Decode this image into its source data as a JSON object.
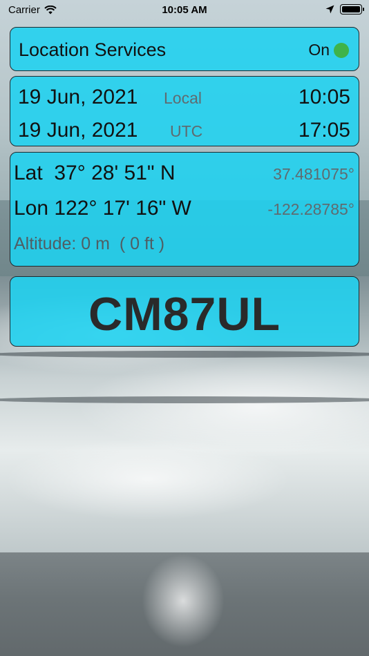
{
  "status_bar": {
    "carrier": "Carrier",
    "time": "10:05 AM"
  },
  "location_services": {
    "label": "Location Services",
    "state": "On",
    "indicator_color": "#3fb34a"
  },
  "datetime": {
    "local": {
      "date": "19 Jun, 2021",
      "zone": "Local",
      "time": "10:05"
    },
    "utc": {
      "date": "19 Jun, 2021",
      "zone": "UTC",
      "time": "17:05"
    }
  },
  "position": {
    "lat_dms": "Lat  37° 28' 51\" N",
    "lat_decimal": "37.481075°",
    "lon_dms": "Lon 122° 17' 16\" W",
    "lon_decimal": "-122.28785°",
    "altitude": "Altitude: 0 m  ( 0 ft )"
  },
  "grid_locator": "CM87UL",
  "colors": {
    "panel": "#1ed2f0",
    "secondary_text": "#5f6b70"
  }
}
